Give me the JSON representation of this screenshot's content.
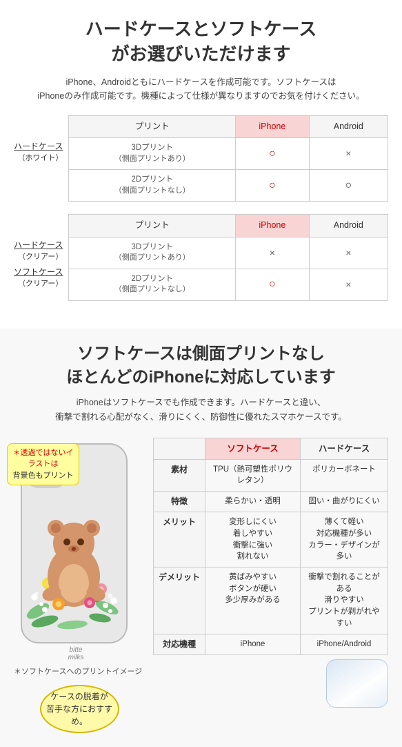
{
  "section1": {
    "title": "ハードケースとソフトケース\nがお選びいただけます",
    "desc": "iPhone、Androidともにハードケースを作成可能です。ソフトケースは\niPhoneのみ作成可能です。機種によって仕様が異なりますのでお気を付けください。",
    "table1": {
      "label_main": "ハードケース",
      "label_sub": "（ホワイト）",
      "col_print": "プリント",
      "col_iphone": "iPhone",
      "col_android": "Android",
      "rows": [
        {
          "print": "3Dプリント\n（側面プリントあり）",
          "iphone": "○",
          "android": "×"
        },
        {
          "print": "2Dプリント\n（側面プリントなし）",
          "iphone": "○",
          "android": "○"
        }
      ]
    },
    "table2": {
      "label1_main": "ハードケース",
      "label1_sub": "（クリアー）",
      "label2_main": "ソフトケース",
      "label2_sub": "（クリアー）",
      "col_print": "プリント",
      "col_iphone": "iPhone",
      "col_android": "Android",
      "rows": [
        {
          "print": "3Dプリント\n（側面プリントあり）",
          "iphone": "×",
          "android": "×"
        },
        {
          "print": "2Dプリント\n（側面プリントなし）",
          "iphone": "○",
          "android": "×"
        }
      ]
    }
  },
  "section2": {
    "title": "ソフトケースは側面プリントなし\nほとんどのiPhoneに対応しています",
    "desc": "iPhoneはソフトケースでも作成できます。ハードケースと違い、\n衝撃で割れる心配がなく、滑りにくく、防御性に優れたスマホケースです。",
    "phone_note": "＊透過ではないイラストは\n背景色もプリント",
    "phone_brand": "bitte\nmilk",
    "phone_caption": "＊ソフトケースへのプリントイメージ",
    "compare": {
      "col_soft": "ソフトケース",
      "col_hard": "ハードケース",
      "rows": [
        {
          "label": "素材",
          "soft": "TPU（熱可塑性ポリウレタン）",
          "hard": "ポリカーボネート"
        },
        {
          "label": "特徴",
          "soft": "柔らかい・透明",
          "hard": "固い・曲がりにくい"
        },
        {
          "label": "メリット",
          "soft": "変形しにくい\n着しやすい\n衝撃に強い\n割れない",
          "hard": "薄くて軽い\n対応機種が多い\nカラー・デザインが多い"
        },
        {
          "label": "デメリット",
          "soft": "黄ばみやすい\nボタンが硬い\n多少厚みがある",
          "hard": "衝撃で割れることがある\n滑りやすい\nプリントが剥がれやすい"
        },
        {
          "label": "対応機種",
          "soft": "iPhone",
          "hard": "iPhone/Android"
        }
      ]
    },
    "recommend": "ケースの脱着が\n苦手な方におすすめ。"
  }
}
